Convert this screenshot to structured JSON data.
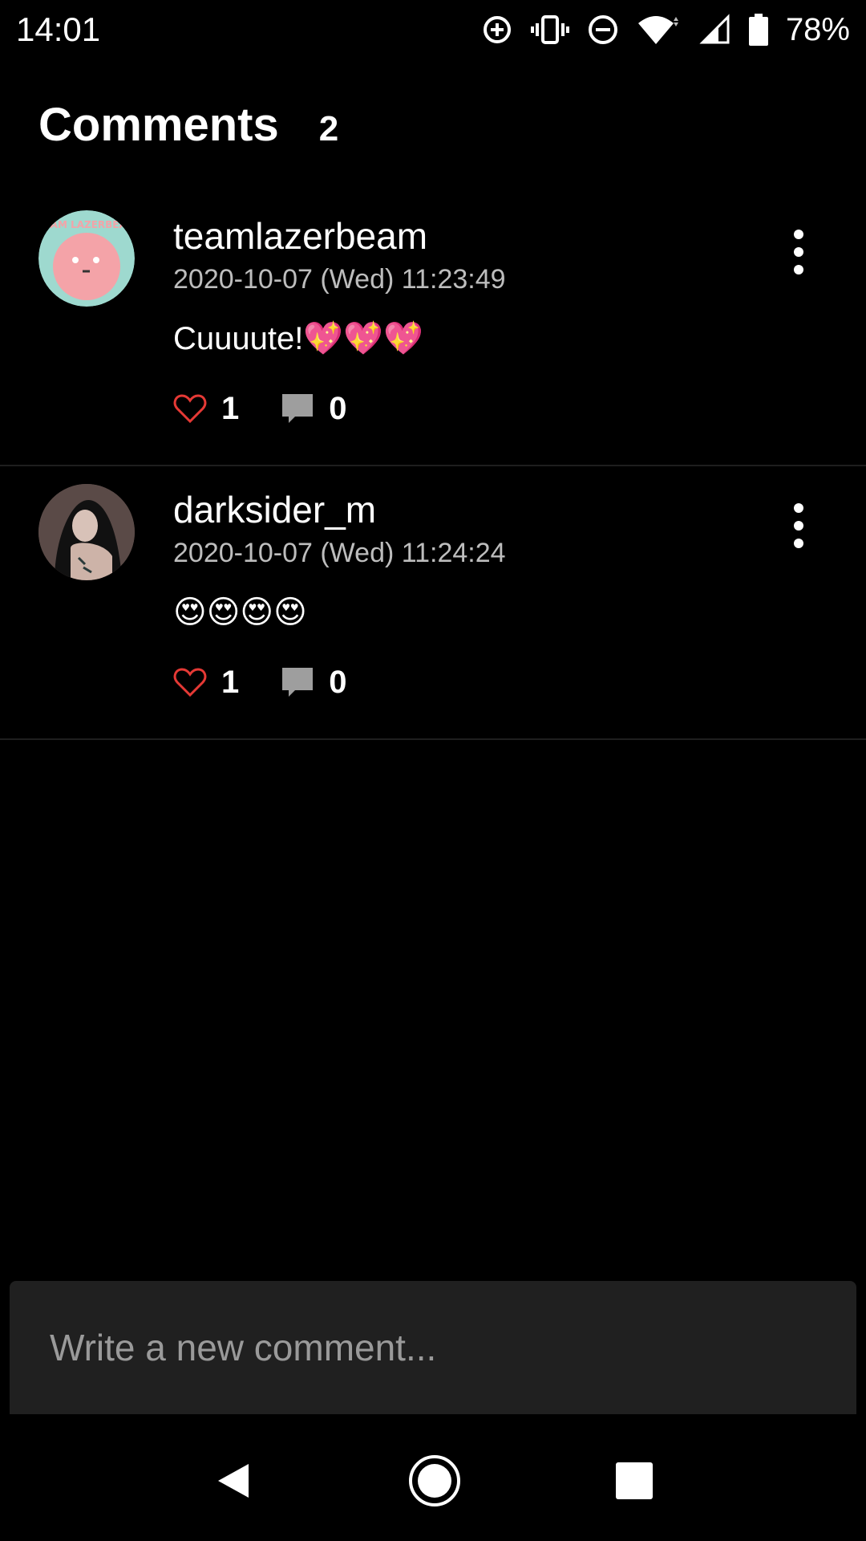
{
  "status_bar": {
    "time": "14:01",
    "battery_percent": "78%",
    "icons": [
      "data-saver-icon",
      "vibrate-icon",
      "do-not-disturb-icon",
      "wifi-icon",
      "cell-signal-icon",
      "battery-icon"
    ]
  },
  "header": {
    "title": "Comments",
    "count": "2"
  },
  "comments": [
    {
      "username": "teamlazerbeam",
      "timestamp": "2020-10-07 (Wed) 11:23:49",
      "text": "Cuuuute!💖💖💖",
      "likes": "1",
      "replies": "0",
      "avatar_colors": {
        "background": "#9ed9cf",
        "face": "#f4a3a8"
      },
      "avatar_text": "TEAM LAZERBEAM"
    },
    {
      "username": "darksider_m",
      "timestamp": "2020-10-07 (Wed) 11:24:24",
      "text": "😍😍😍😍",
      "likes": "1",
      "replies": "0"
    }
  ],
  "composer": {
    "placeholder": "Write a new comment..."
  },
  "colors": {
    "background": "#000000",
    "like_heart": "#e53935",
    "reply_icon": "#9e9e9e",
    "composer_bg": "#202020",
    "timestamp": "#bdbdbd"
  },
  "nav_bar": {
    "icons": [
      "back-icon",
      "home-icon",
      "recents-icon"
    ]
  }
}
